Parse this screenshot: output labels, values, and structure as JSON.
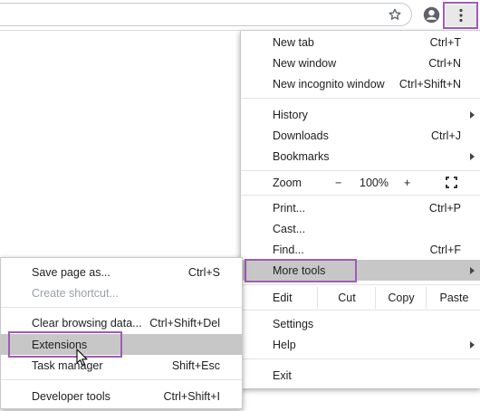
{
  "toolbar": {
    "bookmark_icon": "star-outline-icon",
    "profile_icon": "account-circle-icon",
    "menu_icon": "three-dots-vertical-icon"
  },
  "menu": {
    "new_tab": {
      "label": "New tab",
      "shortcut": "Ctrl+T"
    },
    "new_window": {
      "label": "New window",
      "shortcut": "Ctrl+N"
    },
    "new_incognito": {
      "label": "New incognito window",
      "shortcut": "Ctrl+Shift+N"
    },
    "history": {
      "label": "History"
    },
    "downloads": {
      "label": "Downloads",
      "shortcut": "Ctrl+J"
    },
    "bookmarks": {
      "label": "Bookmarks"
    },
    "zoom": {
      "label": "Zoom",
      "minus": "−",
      "value": "100%",
      "plus": "+"
    },
    "print": {
      "label": "Print...",
      "shortcut": "Ctrl+P"
    },
    "cast": {
      "label": "Cast..."
    },
    "find": {
      "label": "Find...",
      "shortcut": "Ctrl+F"
    },
    "more_tools": {
      "label": "More tools"
    },
    "edit": {
      "label": "Edit",
      "cut": "Cut",
      "copy": "Copy",
      "paste": "Paste"
    },
    "settings": {
      "label": "Settings"
    },
    "help": {
      "label": "Help"
    },
    "exit": {
      "label": "Exit"
    }
  },
  "submenu": {
    "save_page": {
      "label": "Save page as...",
      "shortcut": "Ctrl+S"
    },
    "create_shortcut": {
      "label": "Create shortcut..."
    },
    "clear_browsing": {
      "label": "Clear browsing data...",
      "shortcut": "Ctrl+Shift+Del"
    },
    "extensions": {
      "label": "Extensions"
    },
    "task_manager": {
      "label": "Task manager",
      "shortcut": "Shift+Esc"
    },
    "developer_tools": {
      "label": "Developer tools",
      "shortcut": "Ctrl+Shift+I"
    }
  },
  "colors": {
    "highlight": "#a25bb7",
    "hover_row": "#c7c7c7"
  }
}
